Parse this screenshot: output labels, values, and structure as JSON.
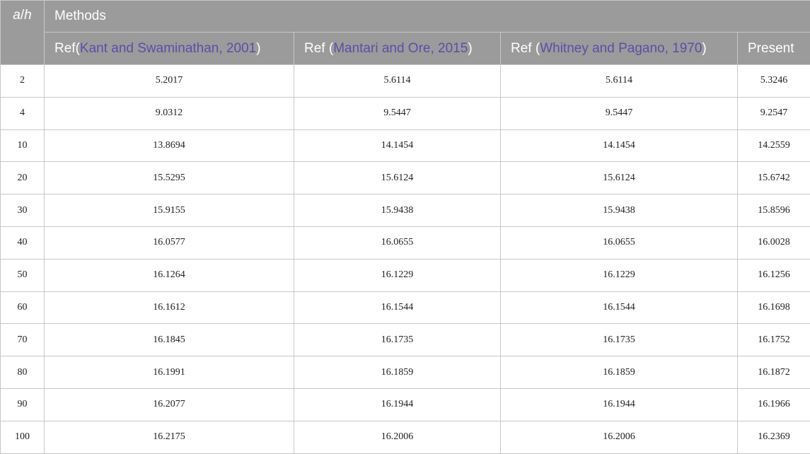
{
  "header": {
    "ah_var1": "a",
    "ah_slash": "/",
    "ah_var2": "h",
    "methods": "Methods",
    "columns": [
      {
        "prefix": "Ref(",
        "citation": "Kant and Swaminathan, 2001",
        "suffix": ")"
      },
      {
        "prefix": "Ref (",
        "citation": "Mantari and Ore, 2015",
        "suffix": ")"
      },
      {
        "prefix": "Ref (",
        "citation": "Whitney and Pagano, 1970",
        "suffix": ")"
      },
      {
        "prefix": "Present",
        "citation": "",
        "suffix": ""
      }
    ]
  },
  "colors": {
    "header_bg": "#9b9b9b",
    "header_text": "#ffffff",
    "citation_link": "#5b4ea8",
    "grid": "#c8c8c8"
  },
  "rows": [
    [
      "2",
      "5.2017",
      "5.6114",
      "5.6114",
      "5.3246"
    ],
    [
      "4",
      "9.0312",
      "9.5447",
      "9.5447",
      "9.2547"
    ],
    [
      "10",
      "13.8694",
      "14.1454",
      "14.1454",
      "14.2559"
    ],
    [
      "20",
      "15.5295",
      "15.6124",
      "15.6124",
      "15.6742"
    ],
    [
      "30",
      "15.9155",
      "15.9438",
      "15.9438",
      "15.8596"
    ],
    [
      "40",
      "16.0577",
      "16.0655",
      "16.0655",
      "16.0028"
    ],
    [
      "50",
      "16.1264",
      "16.1229",
      "16.1229",
      "16.1256"
    ],
    [
      "60",
      "16.1612",
      "16.1544",
      "16.1544",
      "16.1698"
    ],
    [
      "70",
      "16.1845",
      "16.1735",
      "16.1735",
      "16.1752"
    ],
    [
      "80",
      "16.1991",
      "16.1859",
      "16.1859",
      "16.1872"
    ],
    [
      "90",
      "16.2077",
      "16.1944",
      "16.1944",
      "16.1966"
    ],
    [
      "100",
      "16.2175",
      "16.2006",
      "16.2006",
      "16.2369"
    ]
  ]
}
